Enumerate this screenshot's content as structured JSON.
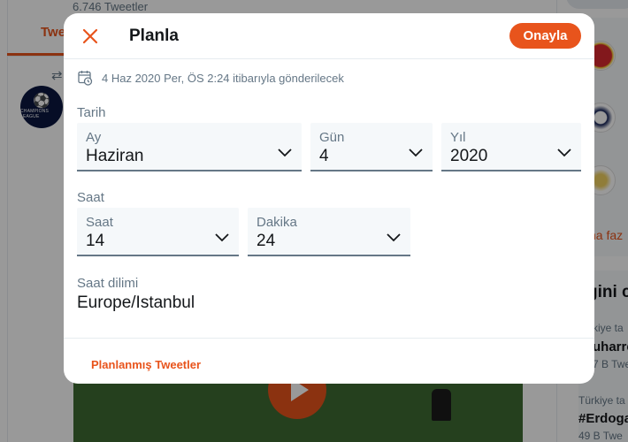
{
  "background": {
    "tweet_count": "6.746 Tweetler",
    "active_tab": "Twe",
    "avatar_text": "CHAMPIONS LEAGUE",
    "show_more": "ha faz",
    "trends_title": "gini c",
    "trend_items": [
      {
        "context": "kiye ta",
        "name": "uharre",
        "count": "7 B Twe"
      },
      {
        "context": "Türkiye ta",
        "name": "#Erdoga",
        "count": "49 B Twe"
      }
    ]
  },
  "modal": {
    "title": "Planla",
    "confirm_label": "Onayla",
    "schedule_text": "4 Haz 2020 Per, ÖS 2:24 itibarıyla gönderilecek",
    "date_section": {
      "label": "Tarih",
      "month": {
        "label": "Ay",
        "value": "Haziran"
      },
      "day": {
        "label": "Gün",
        "value": "4"
      },
      "year": {
        "label": "Yıl",
        "value": "2020"
      }
    },
    "time_section": {
      "label": "Saat",
      "hour": {
        "label": "Saat",
        "value": "14"
      },
      "minute": {
        "label": "Dakika",
        "value": "24"
      }
    },
    "timezone": {
      "label": "Saat dilimi",
      "value": "Europe/Istanbul"
    },
    "footer_link": "Planlanmış Tweetler"
  },
  "colors": {
    "accent": "#e8541c",
    "text_primary": "#14171a",
    "text_secondary": "#657786",
    "field_bg": "#f5f8fa"
  }
}
